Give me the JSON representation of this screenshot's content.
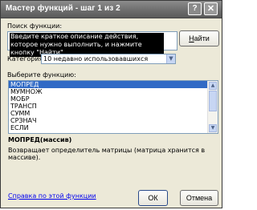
{
  "window": {
    "title": "Мастер функций - шаг 1 из 2",
    "help_glyph": "?",
    "close_glyph": "✕"
  },
  "search": {
    "label": "Поиск функции:",
    "text": "Введите краткое описание действия, которое нужно выполнить, и нажмите кнопку \"Найти\"",
    "find_label_u": "Н",
    "find_label_rest": "айти"
  },
  "category": {
    "label": "Категория:",
    "selected": "10 недавно использовавшихся",
    "arrow_glyph": "▼"
  },
  "functions": {
    "label": "Выберите функцию:",
    "items": [
      "МОПРЕД",
      "МУМНОЖ",
      "МОБР",
      "ТРАНСП",
      "СУММ",
      "СРЗНАЧ",
      "ЕСЛИ"
    ],
    "selected": "МОПРЕД",
    "scroll_up_glyph": "▲",
    "scroll_down_glyph": "▼"
  },
  "details": {
    "signature": "МОПРЕД(массив)",
    "description": "Возвращает определитель матрицы (матрица хранится в массиве)."
  },
  "footer": {
    "help_link": "Справка по этой функции",
    "ok_label": "ОК",
    "cancel_label": "Отмена"
  },
  "colors": {
    "titlebar": "#6e6e6e",
    "selection": "#316ac5",
    "link": "#0000ee",
    "dialog_bg": "#ece9d8"
  }
}
